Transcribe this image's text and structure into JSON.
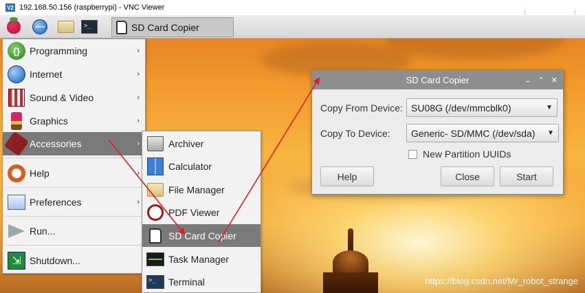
{
  "vnc": {
    "logo": "V2",
    "title": "192.168.50.156 (raspberrypi) - VNC Viewer"
  },
  "taskbar": {
    "icons": [
      "raspberry-icon",
      "globe-icon",
      "folder-icon",
      "terminal-icon"
    ],
    "terminal_glyph": ">_",
    "task_label": "SD Card Copier"
  },
  "menu": {
    "items": [
      {
        "label": "Programming",
        "icon": "programming-icon",
        "submenu": true,
        "glyph": "{}"
      },
      {
        "label": "Internet",
        "icon": "globe-icon",
        "submenu": true
      },
      {
        "label": "Sound & Video",
        "icon": "sound-video-icon",
        "submenu": true
      },
      {
        "label": "Graphics",
        "icon": "graphics-icon",
        "submenu": true
      },
      {
        "label": "Accessories",
        "icon": "accessories-icon",
        "submenu": true,
        "active": true
      },
      {
        "label": "Help",
        "icon": "help-icon",
        "submenu": true
      },
      {
        "label": "Preferences",
        "icon": "preferences-icon",
        "submenu": true
      },
      {
        "label": "Run...",
        "icon": "run-icon",
        "submenu": false
      },
      {
        "label": "Shutdown...",
        "icon": "shutdown-icon",
        "submenu": false
      }
    ],
    "arrow": "›"
  },
  "submenu": {
    "items": [
      {
        "label": "Archiver",
        "icon": "archiver-icon"
      },
      {
        "label": "Calculator",
        "icon": "calculator-icon"
      },
      {
        "label": "File Manager",
        "icon": "file-manager-icon"
      },
      {
        "label": "PDF Viewer",
        "icon": "pdf-viewer-icon"
      },
      {
        "label": "SD Card Copier",
        "icon": "sd-card-icon",
        "active": true
      },
      {
        "label": "Task Manager",
        "icon": "task-manager-icon"
      },
      {
        "label": "Terminal",
        "icon": "terminal-icon",
        "glyph": ">_"
      }
    ]
  },
  "dialog": {
    "title": "SD Card Copier",
    "controls": [
      "⌄",
      "⌃",
      "✕"
    ],
    "copy_from_label": "Copy From Device:",
    "copy_from_value": "SU08G  (/dev/mmcblk0)",
    "copy_to_label": "Copy To Device:",
    "copy_to_value": "Generic- SD/MMC  (/dev/sda)",
    "checkbox_label": "New Partition UUIDs",
    "checkbox_checked": false,
    "help_button": "Help",
    "close_button": "Close",
    "start_button": "Start",
    "caret": "▼"
  },
  "annotation": {
    "arrow_color": "#e02020"
  },
  "watermark": "https://blog.csdn.net/Mr_robot_strange"
}
